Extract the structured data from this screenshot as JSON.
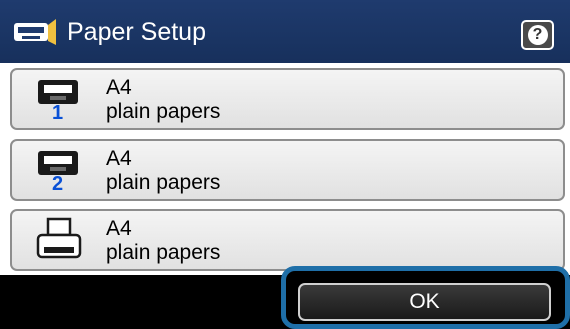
{
  "header": {
    "title": "Paper Setup",
    "icon": "paper-cassette-icon",
    "help_icon": "help-icon",
    "help_label": "?"
  },
  "items": [
    {
      "tray_number": "1",
      "size": "A4",
      "type": "plain papers",
      "icon": "paper-cassette-icon"
    },
    {
      "tray_number": "2",
      "size": "A4",
      "type": "plain papers",
      "icon": "paper-cassette-icon"
    },
    {
      "size": "A4",
      "type": "plain papers",
      "icon": "rear-feed-slot-icon"
    }
  ],
  "footer": {
    "ok_label": "OK"
  },
  "colors": {
    "header_background": "#1f3b6e",
    "tray_number": "#0a51d6",
    "ok_highlight": "#1f6fa8"
  }
}
